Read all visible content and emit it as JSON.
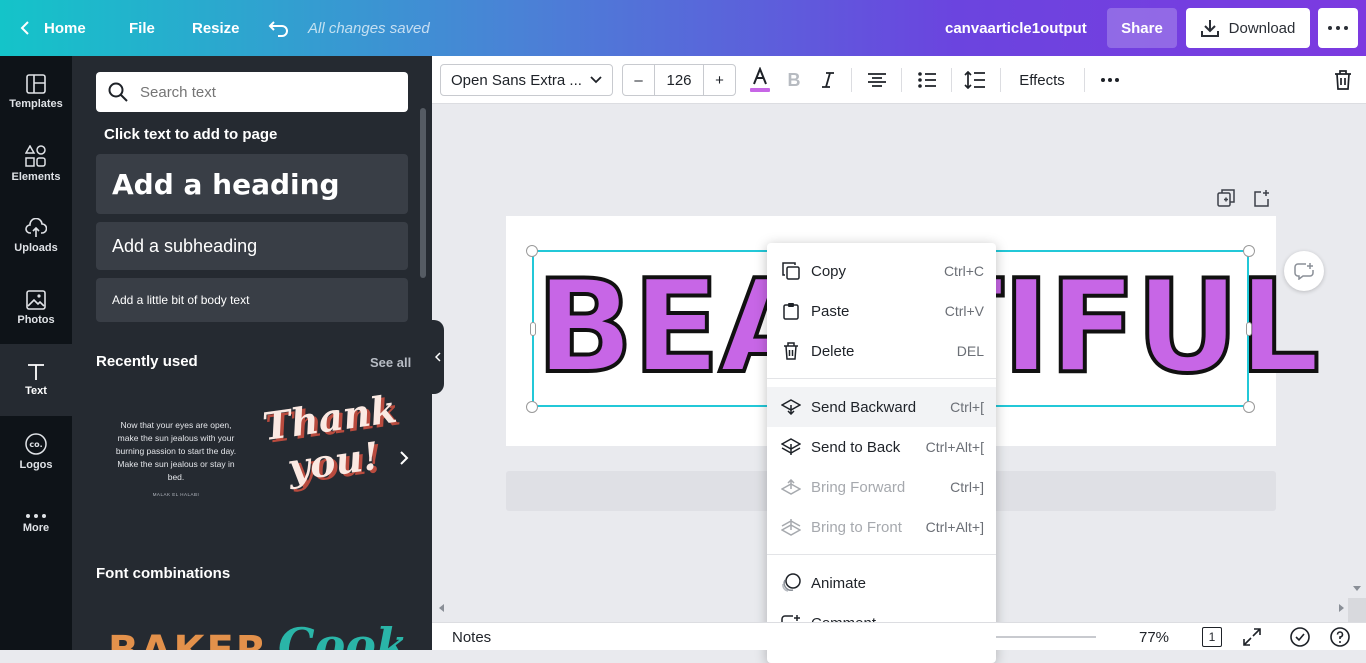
{
  "topbar": {
    "home": "Home",
    "file": "File",
    "resize": "Resize",
    "saved": "All changes saved",
    "doc_title": "canvaarticle1output",
    "share": "Share",
    "download": "Download"
  },
  "rail": [
    {
      "label": "Templates"
    },
    {
      "label": "Elements"
    },
    {
      "label": "Uploads"
    },
    {
      "label": "Photos"
    },
    {
      "label": "Text"
    },
    {
      "label": "Logos"
    },
    {
      "label": "More"
    }
  ],
  "panel": {
    "search_placeholder": "Search text",
    "click_text": "Click text to add to page",
    "heading": "Add a heading",
    "subheading": "Add a subheading",
    "body": "Add a little bit of body text",
    "recently_used": "Recently used",
    "see_all": "See all",
    "recent1_text": "Now that your eyes are open, make the sun jealous with your burning passion to start the day. Make the sun jealous or stay in bed.",
    "recent1_author": "MALAK EL HALABI",
    "recent2_line1": "Thank",
    "recent2_line2": "you!",
    "font_combinations": "Font combinations",
    "combo1": "BAKER",
    "combo2": "Cook"
  },
  "toolbar": {
    "font": "Open Sans Extra ...",
    "size": "126",
    "minus": "–",
    "plus": "+",
    "effects": "Effects",
    "text_color": "#c766e6"
  },
  "canvas": {
    "text": "BEAUTIFUL"
  },
  "context_menu": [
    {
      "label": "Copy",
      "shortcut": "Ctrl+C",
      "icon": "copy-icon"
    },
    {
      "label": "Paste",
      "shortcut": "Ctrl+V",
      "icon": "paste-icon"
    },
    {
      "label": "Delete",
      "shortcut": "DEL",
      "icon": "trash-icon"
    },
    {
      "label": "Send Backward",
      "shortcut": "Ctrl+[",
      "icon": "send-backward-icon"
    },
    {
      "label": "Send to Back",
      "shortcut": "Ctrl+Alt+[",
      "icon": "send-to-back-icon"
    },
    {
      "label": "Bring Forward",
      "shortcut": "Ctrl+]",
      "icon": "bring-forward-icon"
    },
    {
      "label": "Bring to Front",
      "shortcut": "Ctrl+Alt+]",
      "icon": "bring-to-front-icon"
    },
    {
      "label": "Animate",
      "shortcut": "",
      "icon": "animate-icon"
    },
    {
      "label": "Comment",
      "shortcut": "",
      "icon": "comment-icon"
    }
  ],
  "bottom": {
    "notes": "Notes",
    "zoom": "77%",
    "page": "1"
  }
}
